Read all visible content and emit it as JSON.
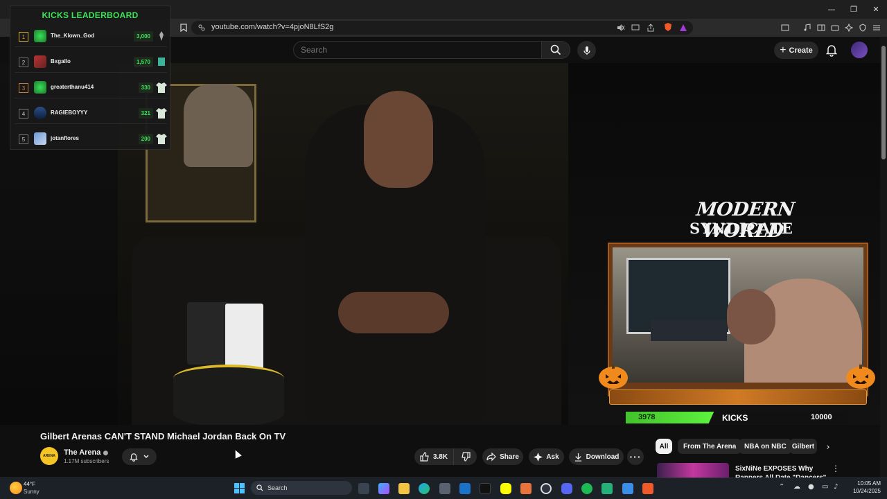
{
  "browser": {
    "url": "youtube.com/watch?v=4pjoN8LfS2g",
    "window_controls": [
      "—",
      "❐",
      "✕"
    ]
  },
  "youtube_header": {
    "search_placeholder": "Search",
    "create_label": "Create"
  },
  "leaderboard": {
    "title": "KICKS LEADERBOARD",
    "rows": [
      {
        "rank": "1",
        "name": "The_Klown_God",
        "score": "3,000"
      },
      {
        "rank": "2",
        "name": "Bxgallo",
        "score": "1,570"
      },
      {
        "rank": "3",
        "name": "greaterthanu414",
        "score": "330"
      },
      {
        "rank": "4",
        "name": "RAGIEBOYYY",
        "score": "321"
      },
      {
        "rank": "5",
        "name": "jotanflores",
        "score": "200"
      }
    ]
  },
  "overlay": {
    "logo_line1": "MODERN WORLD",
    "logo_line2": "SYNDICATE",
    "kicks_current": "3978",
    "kicks_label": "KICKS",
    "kicks_goal": "10000",
    "kicks_progress_fraction": 0.3978
  },
  "video": {
    "title": "Gilbert Arenas CAN'T STAND Michael Jordan Back On TV",
    "channel_name": "The Arena",
    "channel_badge": "ARENA",
    "subscribers": "1.17M subscribers",
    "likes": "3.8K",
    "share_label": "Share",
    "ask_label": "Ask",
    "download_label": "Download"
  },
  "chips": {
    "all": "All",
    "from": "From The Arena",
    "nba": "NBA on NBC",
    "gilbert": "Gilbert"
  },
  "recommended": {
    "title": "SixNiNe EXPOSES Why Rappers All Date \"Dancers\""
  },
  "taskbar": {
    "temperature": "44°F",
    "condition": "Sunny",
    "search_label": "Search",
    "time": "10:05 AM",
    "date": "10/24/2025"
  },
  "colors": {
    "accent_green": "#3fe35a",
    "youtube_bg": "#0f0f0f",
    "overlay_orange": "#d07a25"
  }
}
